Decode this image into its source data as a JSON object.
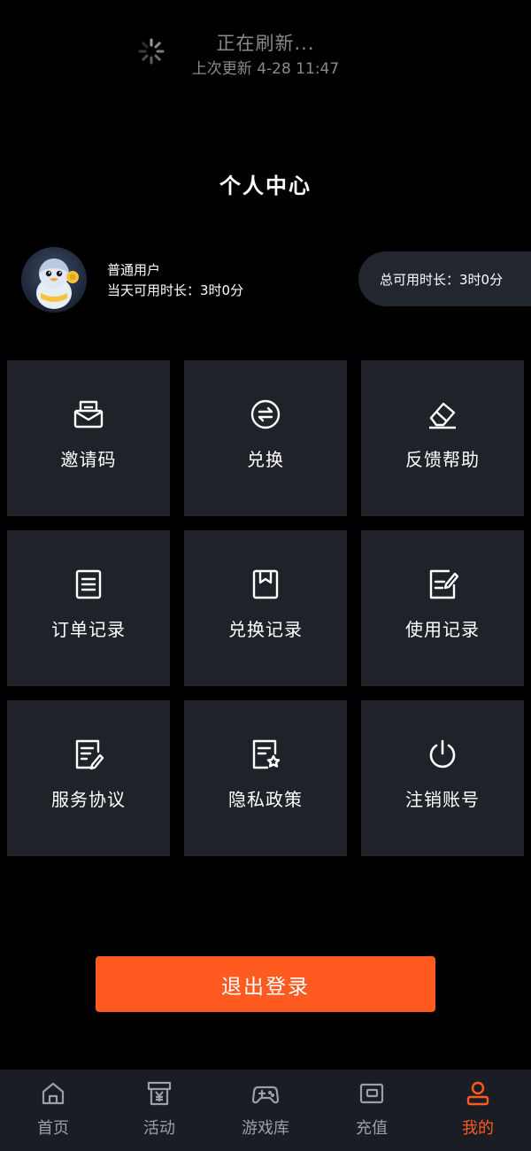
{
  "refresh": {
    "title": "正在刷新...",
    "last_update": "上次更新 4-28 11:47"
  },
  "page_title": "个人中心",
  "user": {
    "type": "普通用户",
    "today_time": "当天可用时长：3时0分",
    "total_time": "总可用时长：3时0分"
  },
  "menu": [
    {
      "label": "邀请码",
      "icon": "envelope-icon"
    },
    {
      "label": "兑换",
      "icon": "exchange-icon"
    },
    {
      "label": "反馈帮助",
      "icon": "eraser-icon"
    },
    {
      "label": "订单记录",
      "icon": "document-icon"
    },
    {
      "label": "兑换记录",
      "icon": "bookmark-icon"
    },
    {
      "label": "使用记录",
      "icon": "edit-document-icon"
    },
    {
      "label": "服务协议",
      "icon": "agreement-icon"
    },
    {
      "label": "隐私政策",
      "icon": "privacy-star-icon"
    },
    {
      "label": "注销账号",
      "icon": "power-icon"
    }
  ],
  "logout_label": "退出登录",
  "nav": [
    {
      "label": "首页",
      "icon": "home-icon"
    },
    {
      "label": "活动",
      "icon": "activity-icon"
    },
    {
      "label": "游戏库",
      "icon": "gamepad-icon"
    },
    {
      "label": "充值",
      "icon": "wallet-icon"
    },
    {
      "label": "我的",
      "icon": "user-icon",
      "active": true
    }
  ],
  "colors": {
    "accent": "#ff5a1f",
    "tile_bg": "#1f2229",
    "nav_bg": "#1a1d23",
    "muted": "#9aa0aa"
  }
}
